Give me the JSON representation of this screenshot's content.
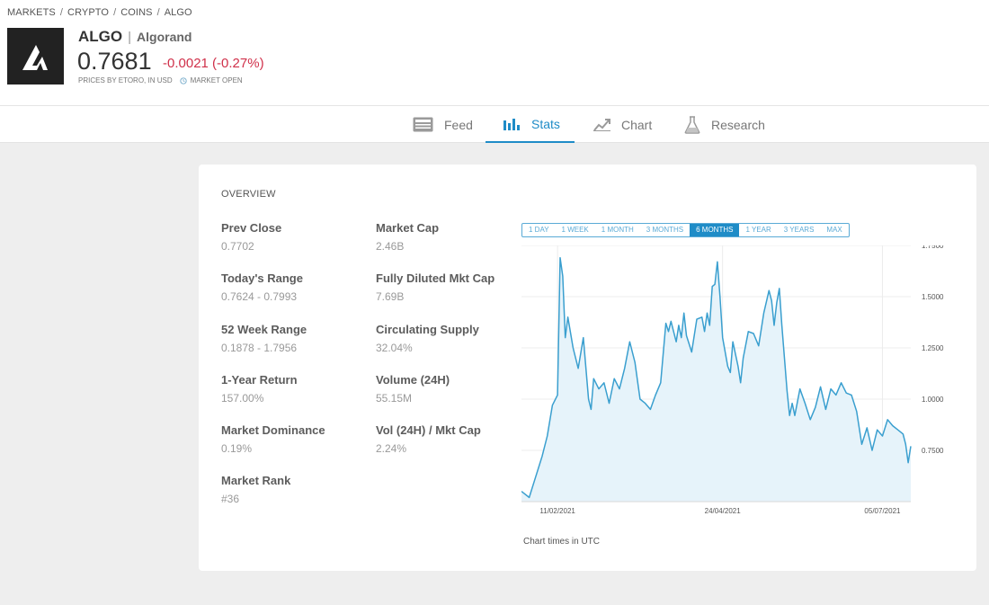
{
  "breadcrumb": [
    "MARKETS",
    "CRYPTO",
    "COINS",
    "ALGO"
  ],
  "instrument": {
    "symbol": "ALGO",
    "name": "Algorand",
    "price": "0.7681",
    "change": "-0.0021 (-0.27%)",
    "change_color": "#d0304a",
    "price_source": "PRICES BY ETORO, IN USD",
    "market_status": "MARKET OPEN"
  },
  "tabs": [
    {
      "label": "Feed",
      "icon": "feed-icon",
      "active": false
    },
    {
      "label": "Stats",
      "icon": "stats-icon",
      "active": true
    },
    {
      "label": "Chart",
      "icon": "chart-icon",
      "active": false
    },
    {
      "label": "Research",
      "icon": "flask-icon",
      "active": false
    }
  ],
  "overview": {
    "title": "OVERVIEW",
    "stats_left": [
      {
        "label": "Prev Close",
        "value": "0.7702"
      },
      {
        "label": "Today's Range",
        "value": "0.7624 - 0.7993"
      },
      {
        "label": "52 Week Range",
        "value": "0.1878 - 1.7956"
      },
      {
        "label": "1-Year Return",
        "value": "157.00%"
      },
      {
        "label": "Market Dominance",
        "value": "0.19%"
      },
      {
        "label": "Market Rank",
        "value": "#36"
      }
    ],
    "stats_right": [
      {
        "label": "Market Cap",
        "value": "2.46B"
      },
      {
        "label": "Fully Diluted Mkt Cap",
        "value": "7.69B"
      },
      {
        "label": "Circulating Supply",
        "value": "32.04%"
      },
      {
        "label": "Volume (24H)",
        "value": "55.15M"
      },
      {
        "label": "Vol (24H) / Mkt Cap",
        "value": "2.24%"
      }
    ]
  },
  "ranges": [
    "1 DAY",
    "1 WEEK",
    "1 MONTH",
    "3 MONTHS",
    "6 MONTHS",
    "1 YEAR",
    "3 YEARS",
    "MAX"
  ],
  "active_range": "6 MONTHS",
  "chart_note": "Chart times in UTC",
  "colors": {
    "accent": "#1f8cc7",
    "line": "#3a9fcf",
    "fill": "#e6f3fa"
  },
  "chart_data": {
    "type": "area",
    "ylim": [
      0.5,
      1.75
    ],
    "yticks": [
      "1.7500",
      "1.5000",
      "1.2500",
      "1.0000",
      "0.7500"
    ],
    "ytick_values": [
      1.75,
      1.5,
      1.25,
      1.0,
      0.75
    ],
    "xticks": [
      "11/02/2021",
      "24/04/2021",
      "05/07/2021"
    ],
    "xtick_positions": [
      14,
      78,
      140
    ],
    "x_count": 152,
    "series": [
      {
        "points": [
          [
            0,
            0.55
          ],
          [
            3,
            0.52
          ],
          [
            5,
            0.6
          ],
          [
            8,
            0.72
          ],
          [
            10,
            0.82
          ],
          [
            12,
            0.97
          ],
          [
            14,
            1.02
          ],
          [
            15,
            1.69
          ],
          [
            16,
            1.6
          ],
          [
            17,
            1.3
          ],
          [
            18,
            1.4
          ],
          [
            20,
            1.25
          ],
          [
            22,
            1.15
          ],
          [
            24,
            1.3
          ],
          [
            26,
            1.0
          ],
          [
            27,
            0.95
          ],
          [
            28,
            1.1
          ],
          [
            30,
            1.05
          ],
          [
            32,
            1.08
          ],
          [
            34,
            0.98
          ],
          [
            36,
            1.1
          ],
          [
            38,
            1.05
          ],
          [
            40,
            1.15
          ],
          [
            42,
            1.28
          ],
          [
            44,
            1.18
          ],
          [
            46,
            1.0
          ],
          [
            48,
            0.98
          ],
          [
            50,
            0.95
          ],
          [
            52,
            1.02
          ],
          [
            54,
            1.08
          ],
          [
            56,
            1.37
          ],
          [
            57,
            1.33
          ],
          [
            58,
            1.38
          ],
          [
            60,
            1.28
          ],
          [
            61,
            1.36
          ],
          [
            62,
            1.3
          ],
          [
            63,
            1.42
          ],
          [
            64,
            1.31
          ],
          [
            66,
            1.23
          ],
          [
            68,
            1.39
          ],
          [
            70,
            1.4
          ],
          [
            71,
            1.33
          ],
          [
            72,
            1.42
          ],
          [
            73,
            1.36
          ],
          [
            74,
            1.55
          ],
          [
            75,
            1.56
          ],
          [
            76,
            1.67
          ],
          [
            77,
            1.5
          ],
          [
            78,
            1.3
          ],
          [
            80,
            1.16
          ],
          [
            81,
            1.13
          ],
          [
            82,
            1.28
          ],
          [
            84,
            1.16
          ],
          [
            85,
            1.08
          ],
          [
            86,
            1.2
          ],
          [
            88,
            1.33
          ],
          [
            90,
            1.32
          ],
          [
            92,
            1.26
          ],
          [
            94,
            1.42
          ],
          [
            96,
            1.53
          ],
          [
            97,
            1.48
          ],
          [
            98,
            1.36
          ],
          [
            99,
            1.47
          ],
          [
            100,
            1.54
          ],
          [
            101,
            1.36
          ],
          [
            102,
            1.2
          ],
          [
            103,
            1.04
          ],
          [
            104,
            0.92
          ],
          [
            105,
            0.98
          ],
          [
            106,
            0.92
          ],
          [
            108,
            1.05
          ],
          [
            110,
            0.98
          ],
          [
            112,
            0.9
          ],
          [
            114,
            0.96
          ],
          [
            116,
            1.06
          ],
          [
            118,
            0.95
          ],
          [
            120,
            1.05
          ],
          [
            122,
            1.02
          ],
          [
            124,
            1.08
          ],
          [
            126,
            1.03
          ],
          [
            128,
            1.02
          ],
          [
            130,
            0.94
          ],
          [
            132,
            0.78
          ],
          [
            134,
            0.86
          ],
          [
            136,
            0.75
          ],
          [
            138,
            0.85
          ],
          [
            140,
            0.82
          ],
          [
            142,
            0.9
          ],
          [
            144,
            0.87
          ],
          [
            146,
            0.85
          ],
          [
            148,
            0.83
          ],
          [
            149,
            0.78
          ],
          [
            150,
            0.69
          ],
          [
            151,
            0.77
          ]
        ]
      }
    ]
  }
}
